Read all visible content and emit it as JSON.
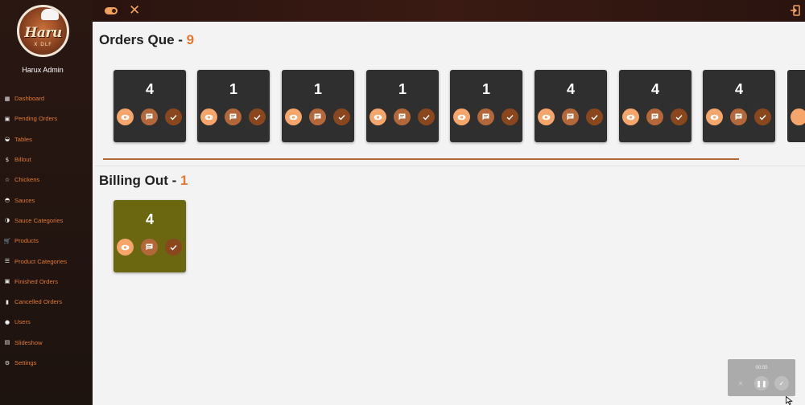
{
  "brand": {
    "logo_text": "Haru",
    "logo_sub": "X DLF"
  },
  "sidebar": {
    "admin_name": "Harux Admin",
    "items": [
      {
        "label": "Dashboard",
        "icon": "dashboard-icon"
      },
      {
        "label": "Pending Orders",
        "icon": "calendar-icon"
      },
      {
        "label": "Tables",
        "icon": "table-icon"
      },
      {
        "label": "Billout",
        "icon": "dollar-icon"
      },
      {
        "label": "Chickens",
        "icon": "star-icon"
      },
      {
        "label": "Sauces",
        "icon": "bowl-icon"
      },
      {
        "label": "Sauce Categories",
        "icon": "category-icon"
      },
      {
        "label": "Products",
        "icon": "cart-icon"
      },
      {
        "label": "Product Categories",
        "icon": "list-icon"
      },
      {
        "label": "Finished Orders",
        "icon": "calendar-check-icon"
      },
      {
        "label": "Cancelled Orders",
        "icon": "trash-icon"
      },
      {
        "label": "Users",
        "icon": "user-icon"
      },
      {
        "label": "Slideshow",
        "icon": "images-icon"
      },
      {
        "label": "Settings",
        "icon": "gear-icon"
      }
    ]
  },
  "orders_queue": {
    "title": "Orders Que - ",
    "count": "9",
    "cards": [
      "4",
      "1",
      "1",
      "1",
      "1",
      "4",
      "4",
      "4"
    ]
  },
  "billing_out": {
    "title": "Billing Out - ",
    "count": "1",
    "cards": [
      "4"
    ]
  },
  "recorder": {
    "time": "00:00"
  },
  "colors": {
    "accent": "#e07a32",
    "sidebar_bg": "#1d130f",
    "card_bg": "#2f2f2f",
    "billing_card_bg": "#6b6710"
  }
}
